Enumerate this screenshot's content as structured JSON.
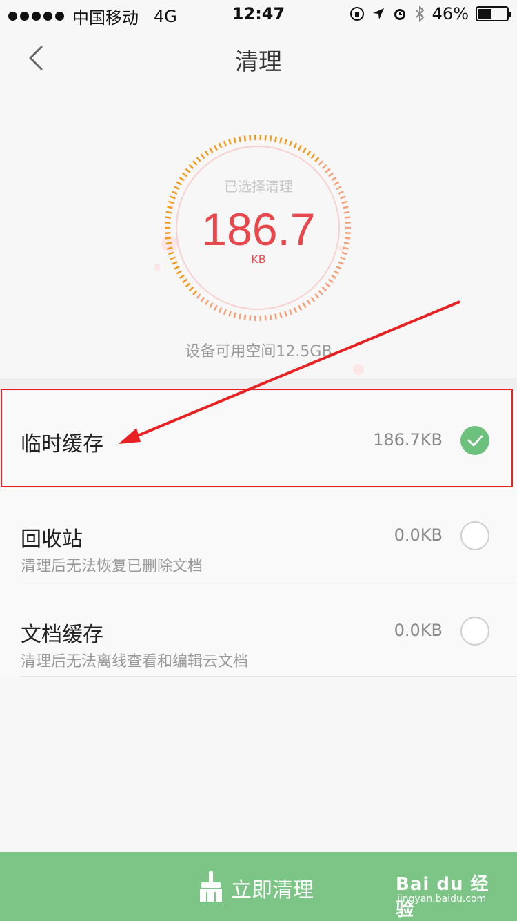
{
  "status_bar": {
    "carrier": "中国移动",
    "network": "4G",
    "time": "12:47",
    "battery": "46%",
    "battery_level": 0.46
  },
  "nav": {
    "title": "清理",
    "back_icon": "chevron-left-icon"
  },
  "gauge": {
    "label": "已选择清理",
    "value": "186.7",
    "unit": "KB",
    "free_space": "设备可用空间12.5GB"
  },
  "items": [
    {
      "title": "临时缓存",
      "subtitle": "",
      "size": "186.7KB",
      "checked": true
    },
    {
      "title": "回收站",
      "subtitle": "清理后无法恢复已删除文档",
      "size": "0.0KB",
      "checked": false
    },
    {
      "title": "文档缓存",
      "subtitle": "清理后无法离线查看和编辑云文档",
      "size": "0.0KB",
      "checked": false
    }
  ],
  "bottom_button": {
    "label": "立即清理",
    "icon": "broom-icon"
  },
  "watermark": {
    "brand": "Bai du 经验",
    "url": "jingyan.baidu.com"
  },
  "colors": {
    "accent_red": "#e8474c",
    "check_green": "#6cc17c",
    "button_green": "#7cc587",
    "annotation_red": "#e82222"
  }
}
